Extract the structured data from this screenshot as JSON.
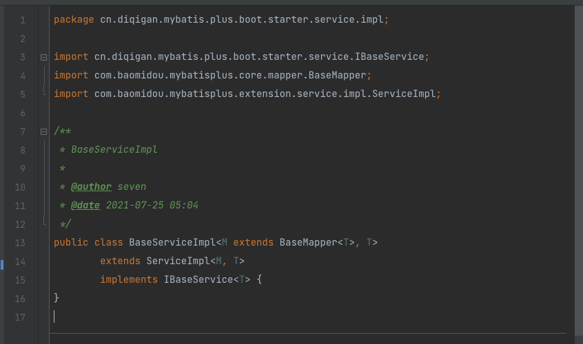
{
  "lines": {
    "l1_kw": "package",
    "l1_rest": " cn.diqigan.mybatis.plus.boot.starter.service.impl",
    "l1_semi": ";",
    "l3_kw": "import",
    "l3_rest": " cn.diqigan.mybatis.plus.boot.starter.service.IBaseService",
    "l3_semi": ";",
    "l4_kw": "import",
    "l4_rest": " com.baomidou.mybatisplus.core.mapper.BaseMapper",
    "l4_semi": ";",
    "l5_kw": "import",
    "l5_rest": " com.baomidou.mybatisplus.extension.service.impl.ServiceImpl",
    "l5_semi": ";",
    "l7": "/**",
    "l8": " * BaseServiceImpl",
    "l9": " *",
    "l10_pre": " * ",
    "l10_tag": "@author",
    "l10_post": " seven",
    "l11_pre": " * ",
    "l11_tag": "@date",
    "l11_post": " 2021-07-25 05:04",
    "l12": " */",
    "l13_public": "public ",
    "l13_class": "class ",
    "l13_name": "BaseServiceImpl",
    "l13_lt1": "<",
    "l13_m": "M",
    "l13_sp1": " ",
    "l13_extends1": "extends ",
    "l13_bm": "BaseMapper",
    "l13_lt2": "<",
    "l13_t1": "T",
    "l13_gt1": ">",
    "l13_comma": ",",
    "l13_sp2": " ",
    "l13_t2": "T",
    "l13_gt2": ">",
    "l14_indent": "        ",
    "l14_extends": "extends ",
    "l14_si": "ServiceImpl",
    "l14_lt": "<",
    "l14_m": "M",
    "l14_comma": ",",
    "l14_sp": " ",
    "l14_t": "T",
    "l14_gt": ">",
    "l15_indent": "        ",
    "l15_impl": "implements ",
    "l15_ibs": "IBaseService",
    "l15_lt": "<",
    "l15_t": "T",
    "l15_gt": ">",
    "l15_sp": " ",
    "l15_brace": "{",
    "l16": "}",
    "nums": [
      "1",
      "2",
      "3",
      "4",
      "5",
      "6",
      "7",
      "8",
      "9",
      "10",
      "11",
      "12",
      "13",
      "14",
      "15",
      "16",
      "17"
    ]
  }
}
